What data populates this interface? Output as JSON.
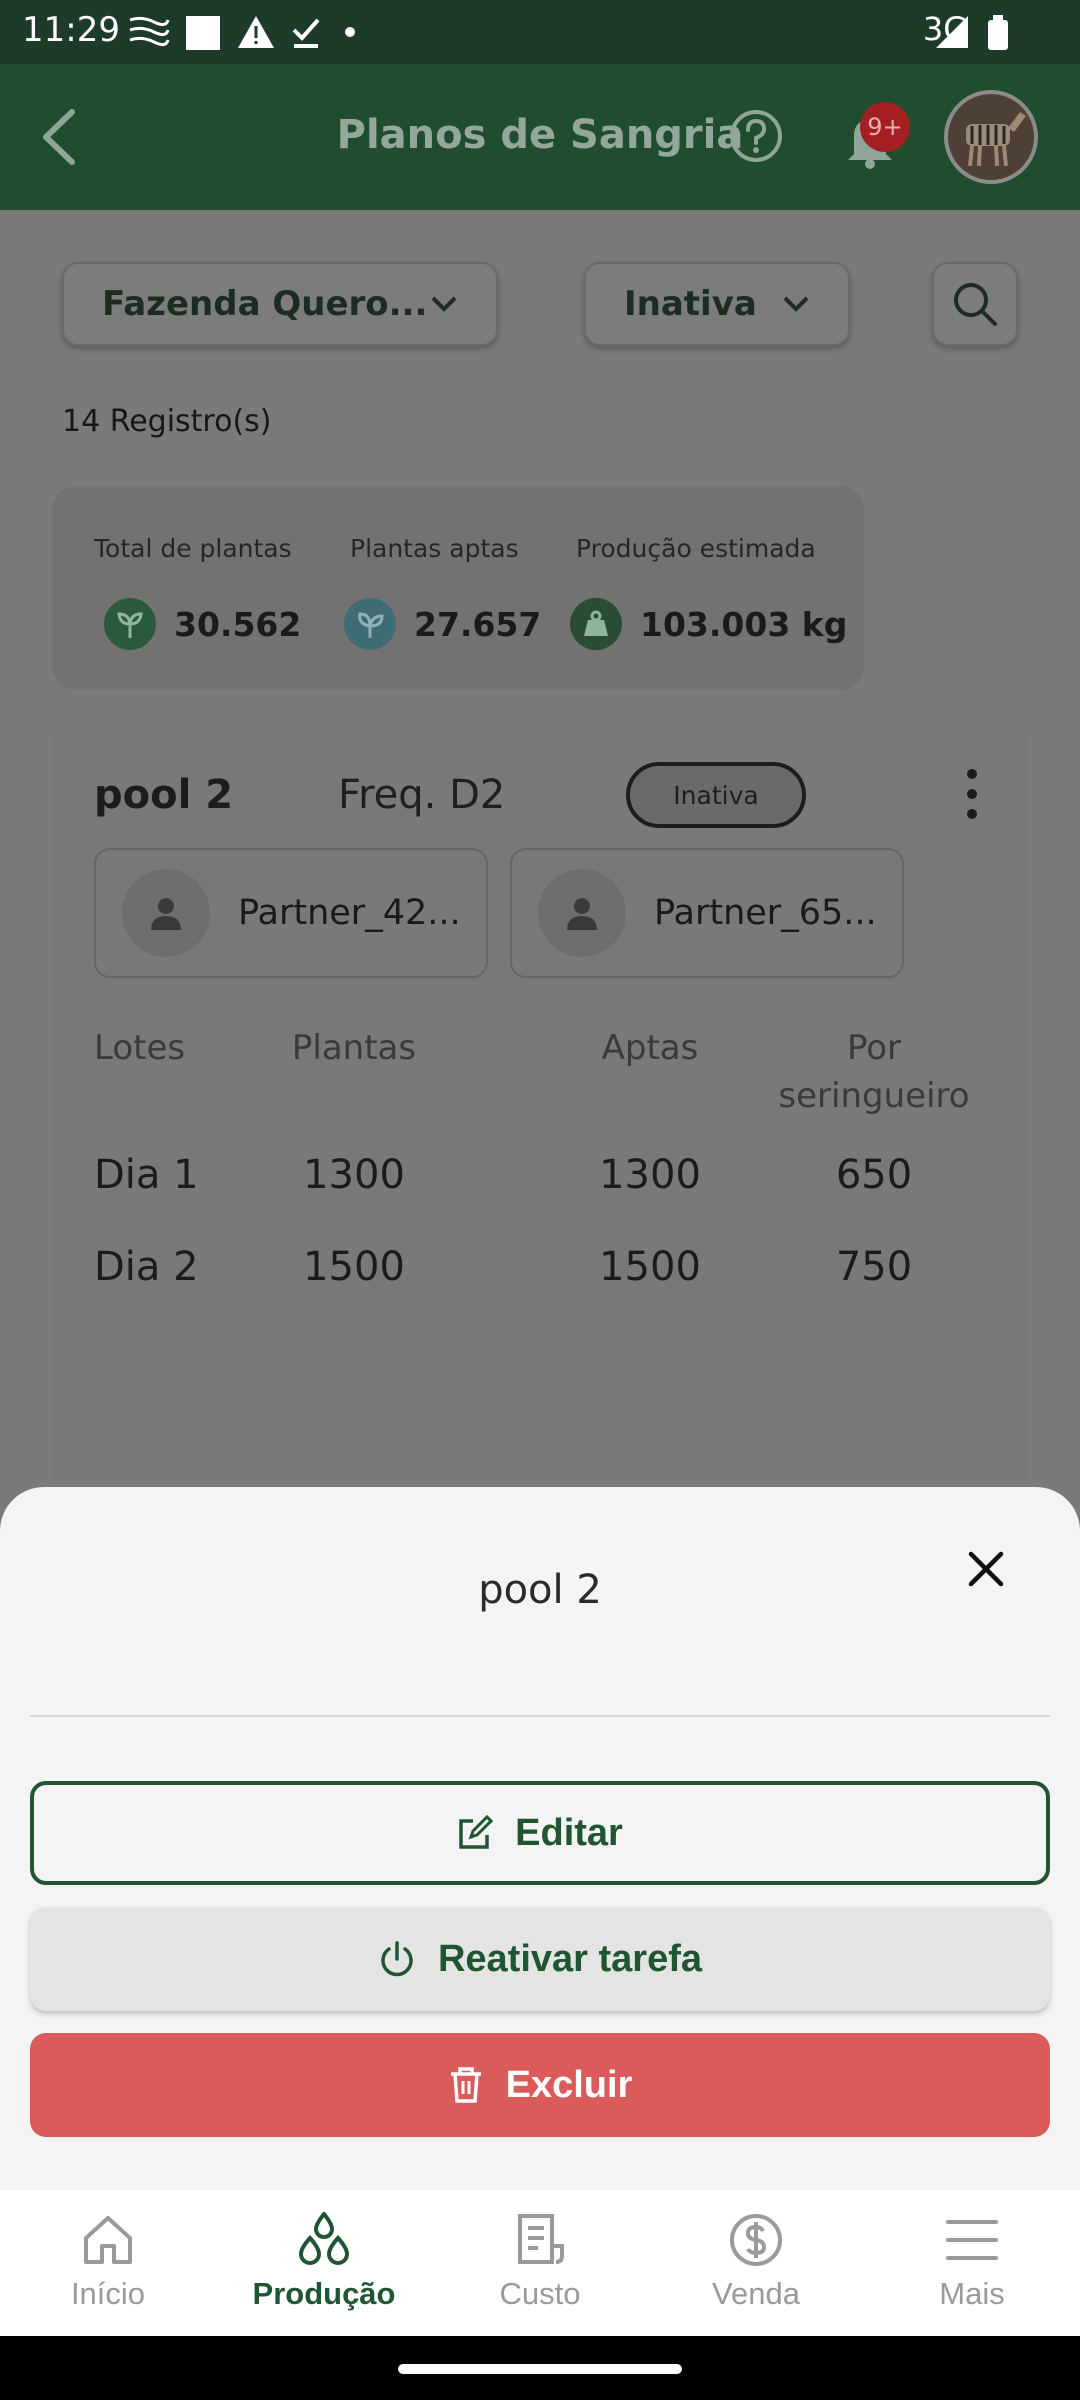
{
  "status_bar": {
    "time": "11:29",
    "network": "3G"
  },
  "app_bar": {
    "title": "Planos de Sangria",
    "notification_badge": "9+"
  },
  "filters": {
    "farm": "Fazenda Quero...",
    "status": "Inativa"
  },
  "records_count": "14 Registro(s)",
  "summary": {
    "total_plants_label": "Total de plantas",
    "total_plants_value": "30.562",
    "fit_plants_label": "Plantas aptas",
    "fit_plants_value": "27.657",
    "production_label": "Produção estimada",
    "production_value": "103.003 kg"
  },
  "card": {
    "name": "pool 2",
    "frequency": "Freq. D2",
    "status_badge": "Inativa",
    "partners": [
      "Partner_42...",
      "Partner_65..."
    ],
    "table": {
      "headers": [
        "Lotes",
        "Plantas",
        "Aptas",
        "Por\nseringueiro"
      ],
      "rows": [
        [
          "Dia 1",
          "1300",
          "1300",
          "650"
        ],
        [
          "Dia 2",
          "1500",
          "1500",
          "750"
        ]
      ]
    }
  },
  "sheet": {
    "title": "pool 2",
    "edit_label": "Editar",
    "reactivate_label": "Reativar tarefa",
    "delete_label": "Excluir"
  },
  "nav": {
    "items": [
      {
        "label": "Início",
        "icon": "home-icon"
      },
      {
        "label": "Produção",
        "icon": "drops-icon",
        "active": true
      },
      {
        "label": "Custo",
        "icon": "receipt-icon"
      },
      {
        "label": "Venda",
        "icon": "dollar-icon"
      },
      {
        "label": "Mais",
        "icon": "menu-icon"
      }
    ]
  },
  "colors": {
    "primary": "#1f5530",
    "danger": "#db5b5b",
    "scrim": "#7a7a7a"
  }
}
